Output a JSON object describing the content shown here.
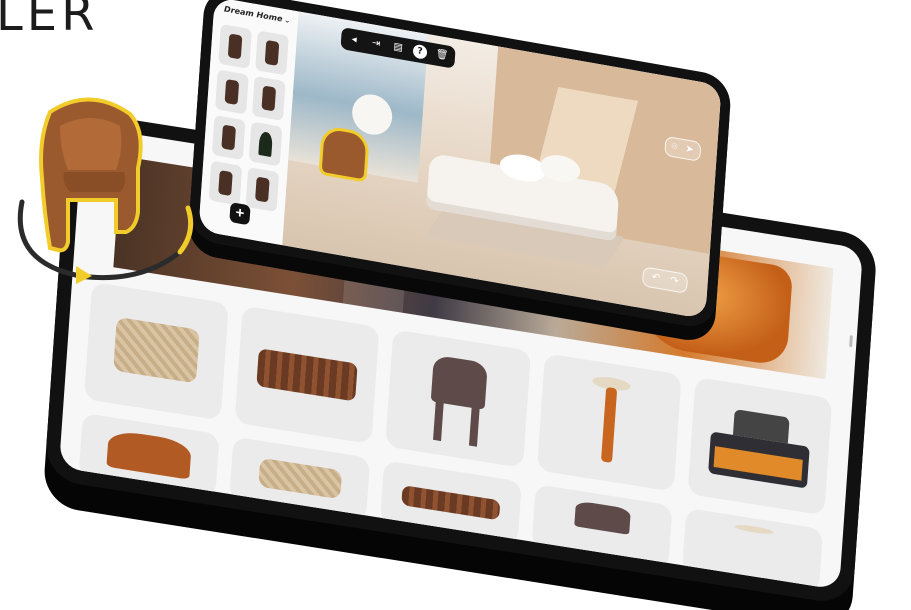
{
  "headline": "LER",
  "planner": {
    "project_title": "Dream Home",
    "project_chevron": "⌄",
    "toolbar": [
      {
        "name": "collapse-icon",
        "glyph": "◂"
      },
      {
        "name": "login-icon",
        "glyph": "⇥"
      },
      {
        "name": "save-icon",
        "glyph": "▤"
      },
      {
        "name": "help-icon",
        "glyph": "?"
      },
      {
        "name": "delete-icon",
        "glyph": "🗑"
      }
    ],
    "add_label": "+",
    "camera_glyph": "⌾",
    "share_glyph": "➤",
    "undo_glyph": "↶",
    "redo_glyph": "↷"
  },
  "colors": {
    "highlight": "#f2cc2a",
    "leather": "#9b5a2e",
    "accent_orange": "#d57a2c"
  }
}
